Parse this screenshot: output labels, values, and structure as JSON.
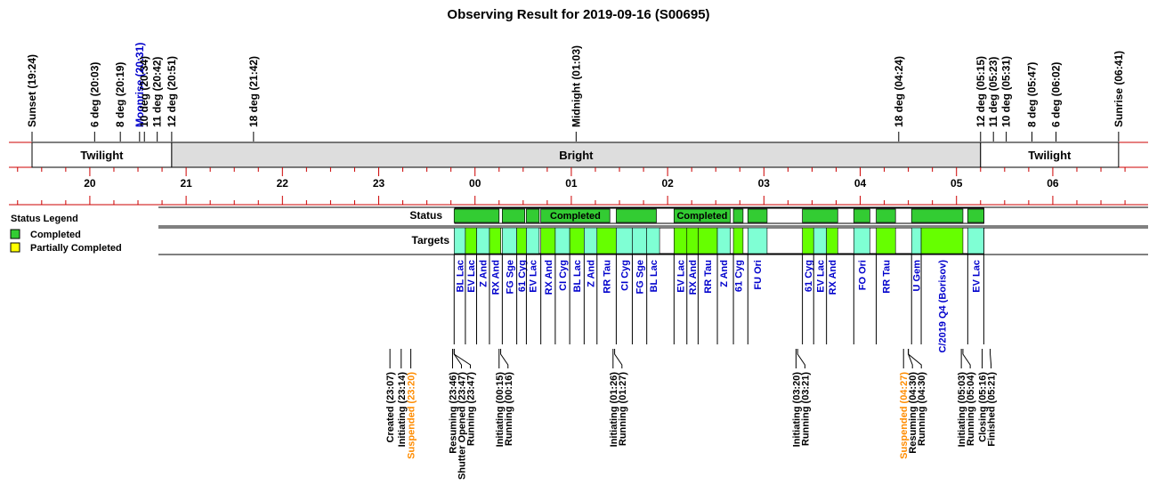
{
  "title": "Observing Result for 2019-09-16 (S00695)",
  "colors": {
    "completed": "#33cc33",
    "target_green": "#66ff00",
    "target_cyan": "#7fffd4",
    "partial": "#ffff00",
    "rule": "#cc0000",
    "bright_band": "#dddddd",
    "blue_label": "#0000cc",
    "orange_label": "#ff8c00"
  },
  "legend": {
    "title": "Status Legend",
    "items": [
      {
        "label": "Completed",
        "color": "#33cc33"
      },
      {
        "label": "Partially Completed",
        "color": "#ffff00"
      }
    ]
  },
  "rows": {
    "status": "Status",
    "targets": "Targets"
  },
  "time_axis": {
    "start": "19:24",
    "end": "06:41",
    "hour_labels": [
      "20",
      "21",
      "22",
      "23",
      "00",
      "01",
      "02",
      "03",
      "04",
      "05",
      "06"
    ]
  },
  "sky_events": [
    {
      "label": "Sunset (19:24)",
      "time": "19:24",
      "color": "black"
    },
    {
      "label": "6 deg (20:03)",
      "time": "20:03",
      "color": "black"
    },
    {
      "label": "8 deg (20:19)",
      "time": "20:19",
      "color": "black"
    },
    {
      "label": "Moonrise (20:31)",
      "time": "20:31",
      "color": "blue"
    },
    {
      "label": "10 deg (20:34)",
      "time": "20:34",
      "color": "black"
    },
    {
      "label": "11 deg (20:42)",
      "time": "20:42",
      "color": "black"
    },
    {
      "label": "12 deg (20:51)",
      "time": "20:51",
      "color": "black"
    },
    {
      "label": "18 deg (21:42)",
      "time": "21:42",
      "color": "black"
    },
    {
      "label": "Midnight (01:03)",
      "time": "01:03",
      "color": "black"
    },
    {
      "label": "18 deg (04:24)",
      "time": "04:24",
      "color": "black"
    },
    {
      "label": "12 deg (05:15)",
      "time": "05:15",
      "color": "black"
    },
    {
      "label": "11 deg (05:23)",
      "time": "05:23",
      "color": "black"
    },
    {
      "label": "10 deg (05:31)",
      "time": "05:31",
      "color": "black"
    },
    {
      "label": "8 deg (05:47)",
      "time": "05:47",
      "color": "black"
    },
    {
      "label": "6 deg (06:02)",
      "time": "06:02",
      "color": "black"
    },
    {
      "label": "Sunrise (06:41)",
      "time": "06:41",
      "color": "black"
    }
  ],
  "bands": [
    {
      "label": "Twilight",
      "start": "19:24",
      "end": "20:51",
      "fill": "white"
    },
    {
      "label": "Bright",
      "start": "20:51",
      "end": "05:15",
      "fill": "gray"
    },
    {
      "label": "Twilight",
      "start": "05:15",
      "end": "06:41",
      "fill": "white"
    }
  ],
  "status_blocks": [
    {
      "start": "23:47",
      "end": "00:15",
      "label": ""
    },
    {
      "start": "00:17",
      "end": "00:31",
      "label": ""
    },
    {
      "start": "00:32",
      "end": "00:40",
      "label": ""
    },
    {
      "start": "00:41",
      "end": "01:24",
      "label": "Completed"
    },
    {
      "start": "01:28",
      "end": "01:53",
      "label": ""
    },
    {
      "start": "02:04",
      "end": "02:39",
      "label": "Completed"
    },
    {
      "start": "02:41",
      "end": "02:47",
      "label": ""
    },
    {
      "start": "02:50",
      "end": "03:02",
      "label": ""
    },
    {
      "start": "03:24",
      "end": "03:46",
      "label": ""
    },
    {
      "start": "03:56",
      "end": "04:06",
      "label": ""
    },
    {
      "start": "04:10",
      "end": "04:22",
      "label": ""
    },
    {
      "start": "04:32",
      "end": "05:04",
      "label": ""
    },
    {
      "start": "05:07",
      "end": "05:17",
      "label": ""
    }
  ],
  "target_blocks": [
    {
      "name": "BL Lac",
      "start": "23:47",
      "end": "23:54",
      "color": "cyan"
    },
    {
      "name": "EV Lac",
      "start": "23:54",
      "end": "24:01",
      "color": "green"
    },
    {
      "name": "Z And",
      "start": "24:01",
      "end": "24:09",
      "color": "cyan"
    },
    {
      "name": "RX And",
      "start": "24:09",
      "end": "24:16",
      "color": "green"
    },
    {
      "name": "FG Sge",
      "start": "24:17",
      "end": "24:26",
      "color": "cyan"
    },
    {
      "name": "61 Cyg",
      "start": "24:26",
      "end": "24:32",
      "color": "green"
    },
    {
      "name": "EV Lac",
      "start": "24:32",
      "end": "24:40",
      "color": "cyan"
    },
    {
      "name": "RX And",
      "start": "24:41",
      "end": "24:50",
      "color": "green"
    },
    {
      "name": "CI Cyg",
      "start": "24:50",
      "end": "24:59",
      "color": "cyan"
    },
    {
      "name": "BL Lac",
      "start": "24:59",
      "end": "25:08",
      "color": "green"
    },
    {
      "name": "Z And",
      "start": "25:08",
      "end": "25:16",
      "color": "cyan"
    },
    {
      "name": "RR Tau",
      "start": "25:16",
      "end": "25:28",
      "color": "green"
    },
    {
      "name": "CI Cyg",
      "start": "25:28",
      "end": "25:38",
      "color": "cyan"
    },
    {
      "name": "FG Sge",
      "start": "25:38",
      "end": "25:47",
      "color": "cyan"
    },
    {
      "name": "BL Lac",
      "start": "25:47",
      "end": "25:55",
      "color": "cyan"
    },
    {
      "name": "EV Lac",
      "start": "26:04",
      "end": "26:12",
      "color": "green"
    },
    {
      "name": "RX And",
      "start": "26:12",
      "end": "26:19",
      "color": "green"
    },
    {
      "name": "RR Tau",
      "start": "26:19",
      "end": "26:31",
      "color": "green"
    },
    {
      "name": "Z And",
      "start": "26:31",
      "end": "26:39",
      "color": "cyan"
    },
    {
      "name": "61 Cyg",
      "start": "26:41",
      "end": "26:47",
      "color": "green"
    },
    {
      "name": "FU Ori",
      "start": "26:50",
      "end": "27:02",
      "color": "cyan"
    },
    {
      "name": "61 Cyg",
      "start": "27:24",
      "end": "27:31",
      "color": "green"
    },
    {
      "name": "EV Lac",
      "start": "27:31",
      "end": "27:39",
      "color": "cyan"
    },
    {
      "name": "RX And",
      "start": "27:39",
      "end": "27:46",
      "color": "green"
    },
    {
      "name": "FO Ori",
      "start": "27:56",
      "end": "28:06",
      "color": "cyan"
    },
    {
      "name": "RR Tau",
      "start": "28:10",
      "end": "28:22",
      "color": "green"
    },
    {
      "name": "U Gem",
      "start": "28:32",
      "end": "28:38",
      "color": "cyan"
    },
    {
      "name": "C/2019 Q4 (Borisov)",
      "start": "28:38",
      "end": "29:04",
      "color": "green"
    },
    {
      "name": "EV Lac",
      "start": "29:07",
      "end": "29:17",
      "color": "cyan"
    }
  ],
  "log_events": [
    {
      "label": "Created (23:07)",
      "time": "23:07",
      "color": "black"
    },
    {
      "label": "Initiating (23:14)",
      "time": "23:14",
      "color": "black"
    },
    {
      "label": "Suspended (23:20)",
      "time": "23:20",
      "color": "orange"
    },
    {
      "label": "Resuming (23:46)",
      "time": "23:46",
      "color": "black"
    },
    {
      "label": "Shutter Opened (23:47)",
      "time": "23:47",
      "color": "black"
    },
    {
      "label": "Running (23:47)",
      "time": "23:47",
      "color": "black"
    },
    {
      "label": "Initiating (00:15)",
      "time": "00:15",
      "color": "black"
    },
    {
      "label": "Running (00:16)",
      "time": "00:16",
      "color": "black"
    },
    {
      "label": "Initiating (01:26)",
      "time": "01:26",
      "color": "black"
    },
    {
      "label": "Running (01:27)",
      "time": "01:27",
      "color": "black"
    },
    {
      "label": "Initiating (03:20)",
      "time": "03:20",
      "color": "black"
    },
    {
      "label": "Running (03:21)",
      "time": "03:21",
      "color": "black"
    },
    {
      "label": "Suspended (04:27)",
      "time": "04:27",
      "color": "orange"
    },
    {
      "label": "Resuming (04:30)",
      "time": "04:30",
      "color": "black"
    },
    {
      "label": "Running (04:30)",
      "time": "04:30",
      "color": "black"
    },
    {
      "label": "Initiating (05:03)",
      "time": "05:03",
      "color": "black"
    },
    {
      "label": "Running (05:04)",
      "time": "05:04",
      "color": "black"
    },
    {
      "label": "Closing (05:16)",
      "time": "05:16",
      "color": "black"
    },
    {
      "label": "Finished (05:21)",
      "time": "05:21",
      "color": "black"
    }
  ]
}
